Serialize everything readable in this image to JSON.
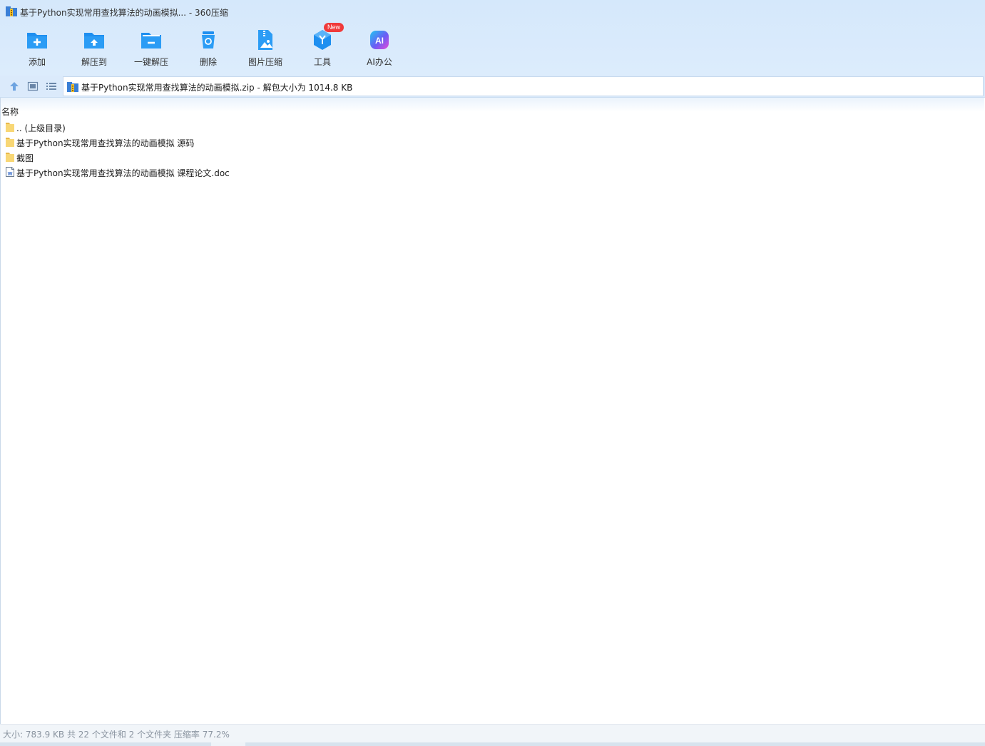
{
  "window": {
    "title": "基于Python实现常用查找算法的动画模拟... - 360压缩",
    "app_icon": "archive-icon"
  },
  "toolbar": {
    "buttons": [
      {
        "label": "添加",
        "icon": "add-folder-icon"
      },
      {
        "label": "解压到",
        "icon": "extract-to-icon"
      },
      {
        "label": "一键解压",
        "icon": "one-click-extract-icon"
      },
      {
        "label": "删除",
        "icon": "trash-icon"
      },
      {
        "label": "图片压缩",
        "icon": "image-compress-icon"
      },
      {
        "label": "工具",
        "icon": "tools-cube-icon",
        "badge": "New"
      },
      {
        "label": "AI办公",
        "icon": "ai-office-icon"
      }
    ]
  },
  "address_bar": {
    "nav": [
      "up-arrow-icon",
      "view-thumbnail-icon",
      "view-list-icon"
    ],
    "path": "基于Python实现常用查找算法的动画模拟.zip - 解包大小为 1014.8 KB"
  },
  "file_list": {
    "column_header": "名称",
    "rows": [
      {
        "name": ".. (上级目录)",
        "icon": "folder-icon"
      },
      {
        "name": "基于Python实现常用查找算法的动画模拟 源码",
        "icon": "folder-icon"
      },
      {
        "name": "截图",
        "icon": "folder-icon"
      },
      {
        "name": "基于Python实现常用查找算法的动画模拟 课程论文.doc",
        "icon": "word-doc-icon"
      }
    ]
  },
  "status_bar": {
    "text": "大小: 783.9 KB 共 22 个文件和 2 个文件夹 压缩率 77.2%"
  },
  "colors": {
    "accent": "#1e8ff0",
    "header_bg": "#d5e8fb",
    "badge": "#f03a3a",
    "folder": "#f8d775"
  }
}
